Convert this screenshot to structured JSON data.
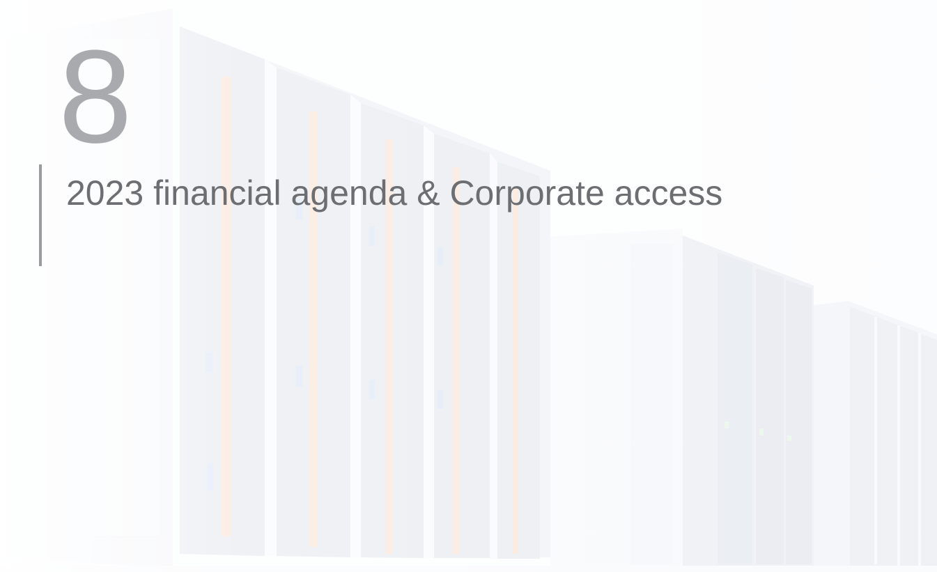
{
  "slide": {
    "section_number": "8",
    "section_title": "2023 financial agenda & Corporate access"
  },
  "background": {
    "description_icon": "server-racks-image",
    "accent_orange": "#f08a4b",
    "accent_blue": "#5b8fd8",
    "accent_green": "#7fd67f",
    "text_gray": "#6d6e71",
    "number_gray": "#a9aaae"
  }
}
